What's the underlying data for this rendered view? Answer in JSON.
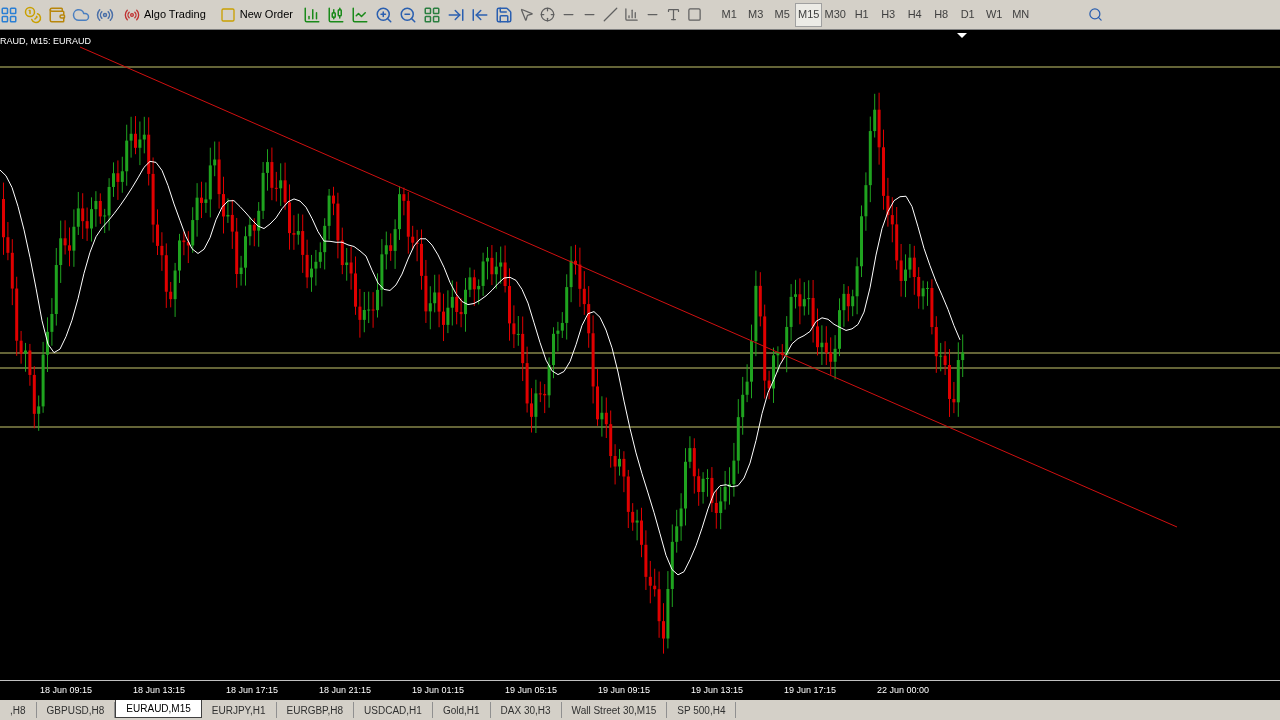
{
  "toolbar": {
    "buttons": [
      {
        "kind": "algo",
        "label": "Algo Trading"
      },
      {
        "kind": "order",
        "label": "New Order"
      }
    ],
    "timeframes": [
      {
        "label": "M1",
        "selected": false
      },
      {
        "label": "M3",
        "selected": false
      },
      {
        "label": "M5",
        "selected": false
      },
      {
        "label": "M15",
        "selected": true
      },
      {
        "label": "M30",
        "selected": false
      },
      {
        "label": "H1",
        "selected": false
      },
      {
        "label": "H3",
        "selected": false
      },
      {
        "label": "H4",
        "selected": false
      },
      {
        "label": "H8",
        "selected": false
      },
      {
        "label": "D1",
        "selected": false
      },
      {
        "label": "W1",
        "selected": false
      },
      {
        "label": "MN",
        "selected": false
      }
    ]
  },
  "chart": {
    "title": "RAUD, M15:  EURAUD"
  },
  "time_axis": [
    "18 Jun 09:15",
    "18 Jun 13:15",
    "18 Jun 17:15",
    "18 Jun 21:15",
    "19 Jun 01:15",
    "19 Jun 05:15",
    "19 Jun 09:15",
    "19 Jun 13:15",
    "19 Jun 17:15",
    "22 Jun 00:00"
  ],
  "tabs": [
    {
      "label": ",H8",
      "selected": false
    },
    {
      "label": "GBPUSD,H8",
      "selected": false
    },
    {
      "label": "EURAUD,M15",
      "selected": true
    },
    {
      "label": "EURJPY,H1",
      "selected": false
    },
    {
      "label": "EURGBP,H8",
      "selected": false
    },
    {
      "label": "USDCAD,H1",
      "selected": false
    },
    {
      "label": "Gold,H1",
      "selected": false
    },
    {
      "label": "DAX 30,H3",
      "selected": false
    },
    {
      "label": "Wall Street 30,M15",
      "selected": false
    },
    {
      "label": "SP 500,H4",
      "selected": false
    }
  ]
}
